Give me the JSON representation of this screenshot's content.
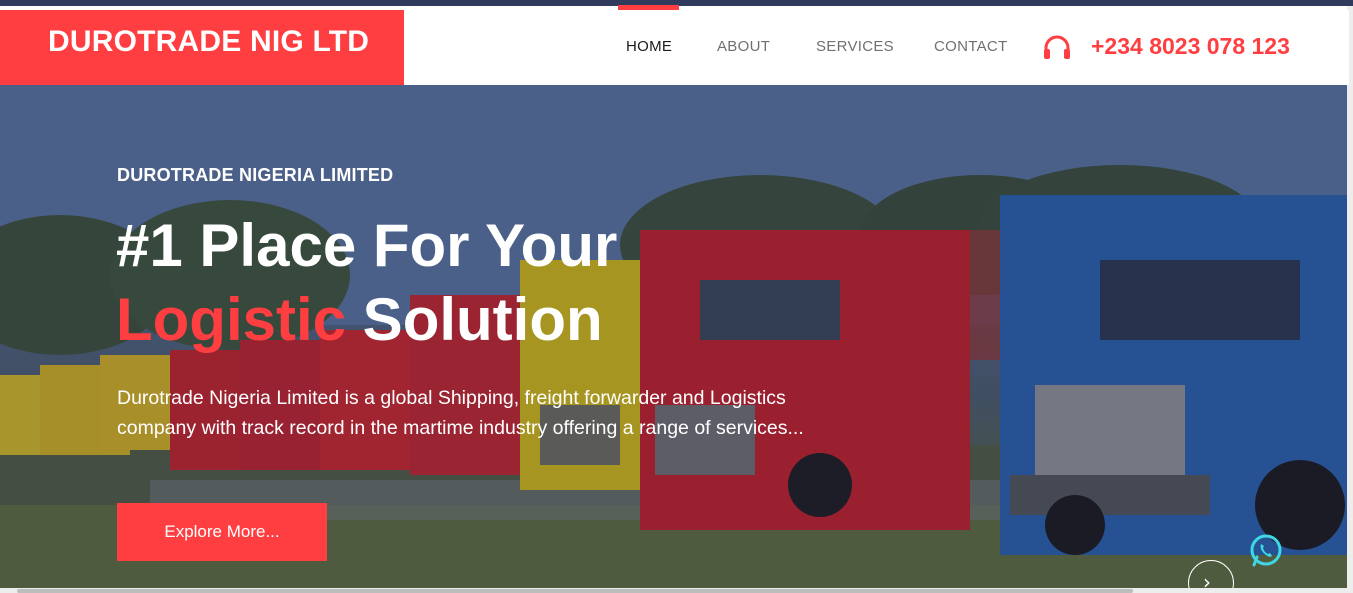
{
  "brand": {
    "name": "DUROTRADE NIG LTD"
  },
  "nav": {
    "items": [
      {
        "label": "HOME",
        "active": true
      },
      {
        "label": "ABOUT",
        "active": false
      },
      {
        "label": "SERVICES",
        "active": false
      },
      {
        "label": "CONTACT",
        "active": false
      }
    ]
  },
  "contact": {
    "phone": "+234 8023 078 123",
    "icon": "headset-icon"
  },
  "hero": {
    "eyebrow": "DUROTRADE NIGERIA LIMITED",
    "headline_line1": "#1 Place For Your",
    "headline_accent": "Logistic",
    "headline_rest": " Solution",
    "description": "Durotrade Nigeria Limited is a global Shipping, freight forwarder and Logistics company with track record in the martime industry offering a range of services...",
    "cta_label": "Explore More...",
    "background_image": "row of parked trucks"
  },
  "widgets": {
    "whatsapp_icon": "whatsapp-icon",
    "next_icon": "chevron-right-icon",
    "next_glyph": "›"
  },
  "colors": {
    "accent": "#ff3e41",
    "topbar": "#2f3a5c",
    "nav_text": "#707070",
    "nav_active": "#1c1c1c"
  }
}
